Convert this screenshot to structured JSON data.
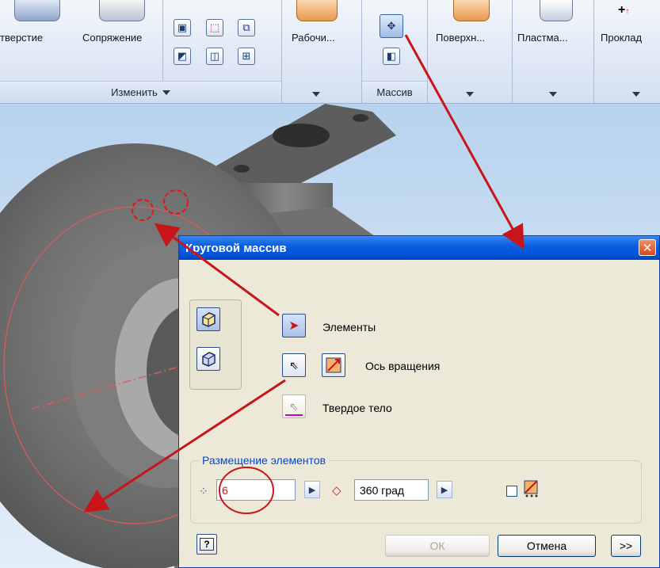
{
  "ribbon": {
    "panel_labels": [
      "тверстие",
      "Сопряжение",
      "Рабочи...",
      "Поверхн...",
      "Пластма...",
      "Проклад"
    ],
    "modify_label": "Изменить",
    "pattern_label": "Массив"
  },
  "dialog": {
    "title": "Круговой массив",
    "close_symbol": "✕",
    "elements_label": "Элементы",
    "axis_label": "Ось вращения",
    "solid_label": "Твердое тело",
    "placement_title": "Размещение элементов",
    "count_value": "6",
    "angle_value": "360 град",
    "ok_label": "ОК",
    "cancel_label": "Отмена",
    "more_label": ">>",
    "help_symbol": "?"
  },
  "colors": {
    "annotation_red": "#c8151a",
    "title_blue": "#0a5fe0",
    "group_title_blue": "#0046d5"
  }
}
